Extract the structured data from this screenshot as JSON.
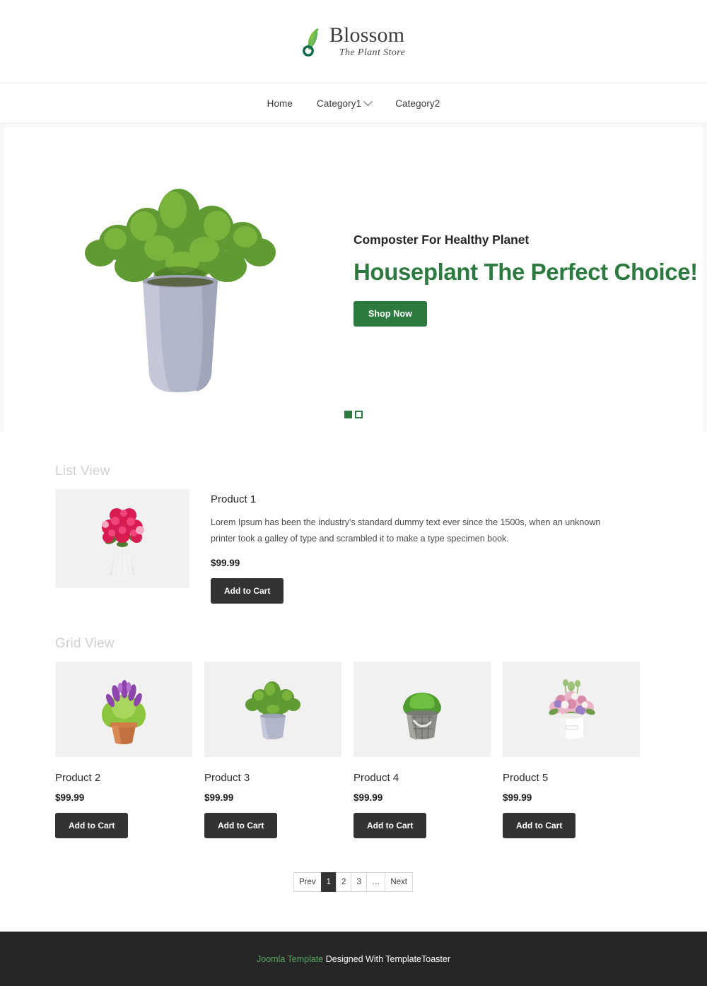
{
  "header": {
    "brand_name": "Blossom",
    "brand_tagline": "The Plant Store",
    "logo_icon": "leaf-sprout-icon"
  },
  "nav": {
    "items": [
      {
        "label": "Home",
        "has_dropdown": false
      },
      {
        "label": "Category1",
        "has_dropdown": true
      },
      {
        "label": "Category2",
        "has_dropdown": false
      }
    ]
  },
  "hero": {
    "subtitle": "Composter For Healthy Planet",
    "title": "Houseplant The Perfect Choice!",
    "cta_label": "Shop Now",
    "image_alt": "green-potted-houseplant",
    "accent_color": "#2d7a41",
    "slides": [
      {
        "active": true
      },
      {
        "active": false
      }
    ]
  },
  "list_view": {
    "section_label": "List View",
    "product": {
      "name": "Product 1",
      "description": "Lorem Ipsum has been the industry's standard dummy text ever since the 1500s, when an unknown printer took a galley of type and scrambled it to make a type specimen book.",
      "price": "$99.99",
      "cta_label": "Add to Cart",
      "image_alt": "red-pink-flower-bouquet"
    }
  },
  "grid_view": {
    "section_label": "Grid View",
    "products": [
      {
        "name": "Product 2",
        "price": "$99.99",
        "cta_label": "Add to Cart",
        "image_alt": "purple-lavender-in-terracotta-pot"
      },
      {
        "name": "Product 3",
        "price": "$99.99",
        "cta_label": "Add to Cart",
        "image_alt": "green-houseplant-in-grey-pot"
      },
      {
        "name": "Product 4",
        "price": "$99.99",
        "cta_label": "Add to Cart",
        "image_alt": "green-shrub-in-rustic-woven-pot"
      },
      {
        "name": "Product 5",
        "price": "$99.99",
        "cta_label": "Add to Cart",
        "image_alt": "pastel-flower-arrangement-in-white-box"
      }
    ]
  },
  "pagination": {
    "prev_label": "Prev",
    "next_label": "Next",
    "pages": [
      "1",
      "2",
      "3",
      "…"
    ],
    "active_page": "1"
  },
  "footer": {
    "link_text": "Joomla Template",
    "text": " Designed With TemplateToaster"
  }
}
